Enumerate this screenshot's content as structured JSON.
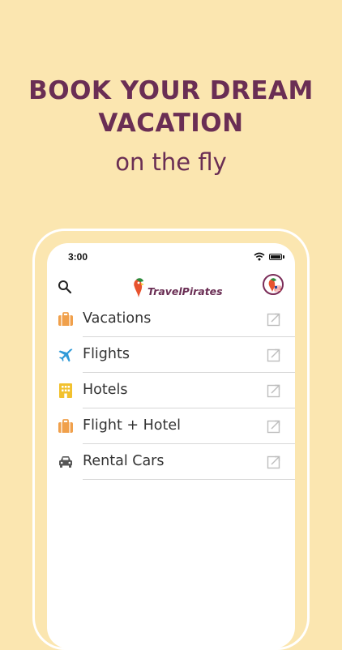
{
  "headline": [
    "BOOK YOUR DREAM",
    "VACATION"
  ],
  "subheadline": "on the fly",
  "status_bar": {
    "time": "3:00"
  },
  "header": {
    "logo_text": "TravelPirates"
  },
  "menu": [
    {
      "label": "Vacations",
      "icon": "suitcase-icon",
      "color": "#f0a04b"
    },
    {
      "label": "Flights",
      "icon": "airplane-icon",
      "color": "#2f9ad8"
    },
    {
      "label": "Hotels",
      "icon": "building-icon",
      "color": "#f2c12e"
    },
    {
      "label": "Flight + Hotel",
      "icon": "suitcase-icon",
      "color": "#f0a04b"
    },
    {
      "label": "Rental Cars",
      "icon": "car-icon",
      "color": "#555555"
    }
  ],
  "colors": {
    "background": "#fbe6b0",
    "brand": "#6a2e54",
    "accent": "#e8532e"
  }
}
